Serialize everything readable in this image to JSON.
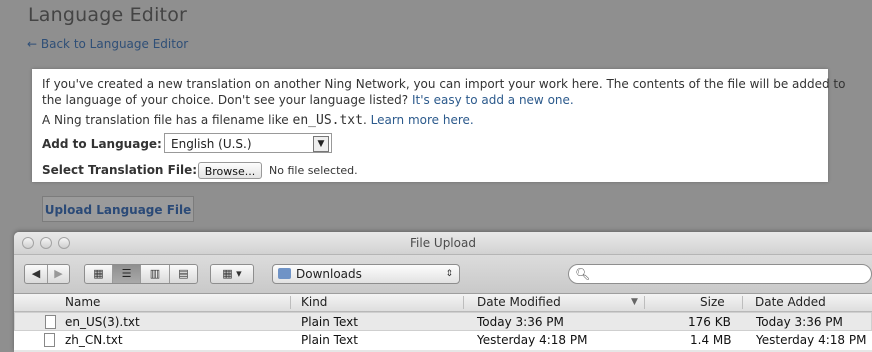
{
  "page": {
    "title": "Language Editor",
    "back_link": "← Back to Language Editor"
  },
  "panel": {
    "intro_text": "If you've created a new translation on another Ning Network, you can import your work here. The contents of the file will be added to",
    "intro_text2": "the language of your choice. Don't see your language listed?",
    "add_link": "It's easy to add a new one.",
    "filename_prefix": "A Ning translation file has a filename like",
    "filename_example": "en_US.txt",
    "learn_more": "Learn more here.",
    "add_label": "Add to Language:",
    "language_value": "English (U.S.)",
    "file_label": "Select Translation File:",
    "browse_label": "Browse...",
    "no_file": "No file selected.",
    "upload_button": "Upload Language File"
  },
  "dialog": {
    "title": "File Upload",
    "location": "Downloads",
    "search_placeholder": "",
    "columns": [
      "Name",
      "Kind",
      "Date Modified",
      "Size",
      "Date Added"
    ],
    "files": [
      {
        "name": "en_US(3).txt",
        "kind": "Plain Text",
        "modified": "Today 3:36 PM",
        "size": "176 KB",
        "added": "Today 3:36 PM"
      },
      {
        "name": "zh_CN.txt",
        "kind": "Plain Text",
        "modified": "Yesterday 4:18 PM",
        "size": "1.4 MB",
        "added": "Yesterday 4:18 PM"
      }
    ]
  }
}
